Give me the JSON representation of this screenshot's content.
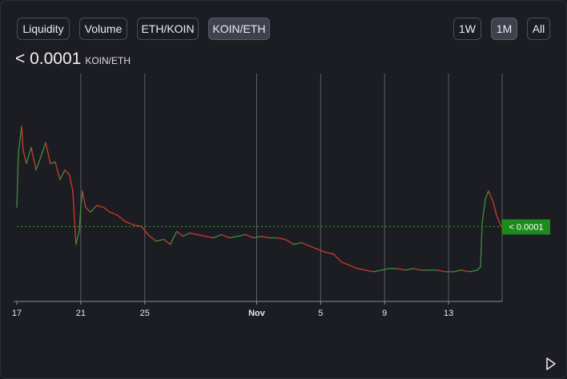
{
  "toolbar": {
    "metric_tabs": [
      "Liquidity",
      "Volume",
      "ETH/KOIN",
      "KOIN/ETH"
    ],
    "active_metric": "KOIN/ETH",
    "range_tabs": [
      "1W",
      "1M",
      "All"
    ],
    "active_range": "1M"
  },
  "header": {
    "price_value": "< 0.0001",
    "price_unit": "KOIN/ETH"
  },
  "current_price_tag": "< 0.0001",
  "colors": {
    "background": "#1c1d23",
    "up": "#3f8f3a",
    "down": "#d0392e",
    "grid": "#5b5e66",
    "tag": "#1c8b1c",
    "reference_line": "#2aa52a"
  },
  "chart_data": {
    "type": "line",
    "title": "",
    "xlabel": "",
    "ylabel": "",
    "x_ticks": [
      "17",
      "21",
      "25",
      "Nov",
      "5",
      "9",
      "13"
    ],
    "x_tick_days": [
      0,
      4,
      8,
      15,
      19,
      23,
      27
    ],
    "xlim_days": [
      0,
      30.3
    ],
    "ylim": [
      0,
      1
    ],
    "y_axis_visible": false,
    "vertical_grid": true,
    "current_value": 0.33,
    "current_label": "< 0.0001",
    "series": [
      {
        "points": [
          [
            0,
            0.45
          ],
          [
            0.1,
            0.78
          ],
          [
            0.3,
            0.95
          ],
          [
            0.4,
            0.8
          ],
          [
            0.6,
            0.72
          ],
          [
            0.9,
            0.82
          ],
          [
            1.2,
            0.68
          ],
          [
            1.5,
            0.76
          ],
          [
            1.8,
            0.85
          ],
          [
            2.1,
            0.72
          ],
          [
            2.4,
            0.73
          ],
          [
            2.7,
            0.62
          ],
          [
            3.0,
            0.68
          ],
          [
            3.3,
            0.65
          ],
          [
            3.5,
            0.55
          ],
          [
            3.7,
            0.22
          ],
          [
            3.9,
            0.3
          ],
          [
            4.0,
            0.45
          ],
          [
            4.1,
            0.55
          ],
          [
            4.3,
            0.45
          ],
          [
            4.6,
            0.42
          ],
          [
            5.0,
            0.46
          ],
          [
            5.4,
            0.45
          ],
          [
            5.8,
            0.42
          ],
          [
            6.3,
            0.4
          ],
          [
            6.8,
            0.36
          ],
          [
            7.3,
            0.34
          ],
          [
            7.8,
            0.33
          ],
          [
            8.2,
            0.28
          ],
          [
            8.7,
            0.24
          ],
          [
            9.2,
            0.25
          ],
          [
            9.6,
            0.22
          ],
          [
            10.0,
            0.3
          ],
          [
            10.4,
            0.27
          ],
          [
            10.8,
            0.29
          ],
          [
            11.3,
            0.28
          ],
          [
            11.8,
            0.27
          ],
          [
            12.3,
            0.26
          ],
          [
            12.8,
            0.28
          ],
          [
            13.3,
            0.26
          ],
          [
            13.8,
            0.27
          ],
          [
            14.3,
            0.28
          ],
          [
            14.8,
            0.26
          ],
          [
            15.3,
            0.27
          ],
          [
            15.8,
            0.26
          ],
          [
            16.3,
            0.26
          ],
          [
            16.8,
            0.25
          ],
          [
            17.3,
            0.22
          ],
          [
            17.8,
            0.23
          ],
          [
            18.3,
            0.21
          ],
          [
            18.8,
            0.19
          ],
          [
            19.3,
            0.17
          ],
          [
            19.8,
            0.16
          ],
          [
            20.3,
            0.11
          ],
          [
            20.8,
            0.09
          ],
          [
            21.3,
            0.07
          ],
          [
            21.8,
            0.06
          ],
          [
            22.3,
            0.05
          ],
          [
            22.8,
            0.06
          ],
          [
            23.3,
            0.07
          ],
          [
            23.8,
            0.07
          ],
          [
            24.3,
            0.06
          ],
          [
            24.8,
            0.07
          ],
          [
            25.3,
            0.06
          ],
          [
            25.8,
            0.06
          ],
          [
            26.3,
            0.06
          ],
          [
            26.8,
            0.05
          ],
          [
            27.3,
            0.05
          ],
          [
            27.8,
            0.06
          ],
          [
            28.3,
            0.05
          ],
          [
            28.8,
            0.06
          ],
          [
            29.0,
            0.08
          ],
          [
            29.1,
            0.35
          ],
          [
            29.3,
            0.5
          ],
          [
            29.5,
            0.55
          ],
          [
            29.8,
            0.48
          ],
          [
            30.0,
            0.4
          ],
          [
            30.3,
            0.33
          ]
        ]
      }
    ]
  }
}
